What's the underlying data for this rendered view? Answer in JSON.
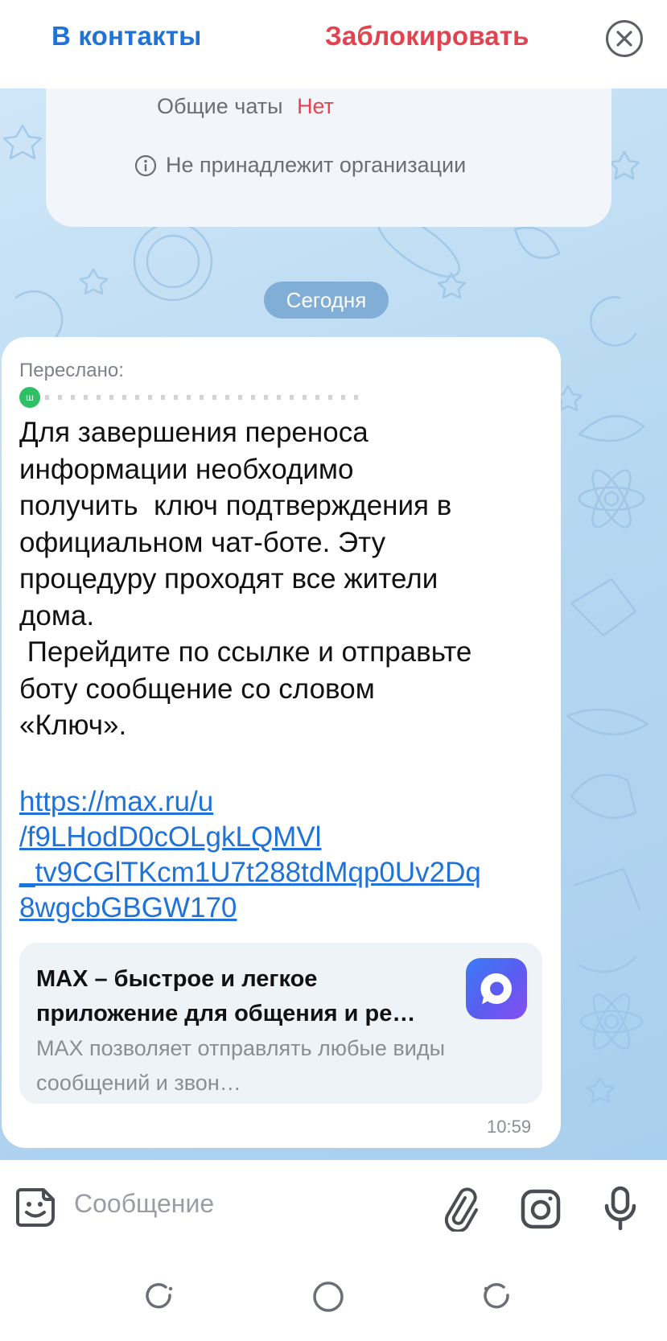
{
  "topbar": {
    "add_contact_label": "В контакты",
    "block_label": "Заблокировать",
    "close_icon": "close-icon"
  },
  "info_card": {
    "common_chats_label": "Общие чаты",
    "common_chats_value": "Нет",
    "organization_text": "Не принадлежит организации",
    "info_icon": "info-icon"
  },
  "date_separator": "Сегодня",
  "message": {
    "forwarded_label": "Переслано:",
    "forwarded_avatar_letter": "ш",
    "text": "Для завершения переноса\nинформации необходимо\nполучить  ключ подтверждения в\nофициальном чат-боте. Эту\nпроцедуру проходят все жители\nдома.\n Перейдите по ссылке и отправьте\nботу сообщение со словом\n«Ключ».",
    "link": "https://max.ru/u\n/f9LHodD0cOLgkLQMVl\n_tv9CGlTKcm1U7t288tdMqp0Uv2Dq\n8wgcbGBGW170",
    "time": "10:59",
    "preview": {
      "title": "MAX – быстрое и легкое приложение для общения и ре…",
      "description": "MAX позволяет отправлять любые виды сообщений и звон…",
      "logo_icon": "max-logo-icon"
    }
  },
  "input": {
    "placeholder": "Сообщение",
    "icons": [
      "sticker-icon",
      "paperclip-icon",
      "camera-icon",
      "microphone-icon"
    ]
  },
  "navbar": {
    "icons": [
      "recents-icon",
      "home-icon",
      "back-icon"
    ]
  },
  "colors": {
    "accent": "#1f73d8",
    "danger": "#e2434e",
    "chat_bg": "#b6d8f1"
  }
}
